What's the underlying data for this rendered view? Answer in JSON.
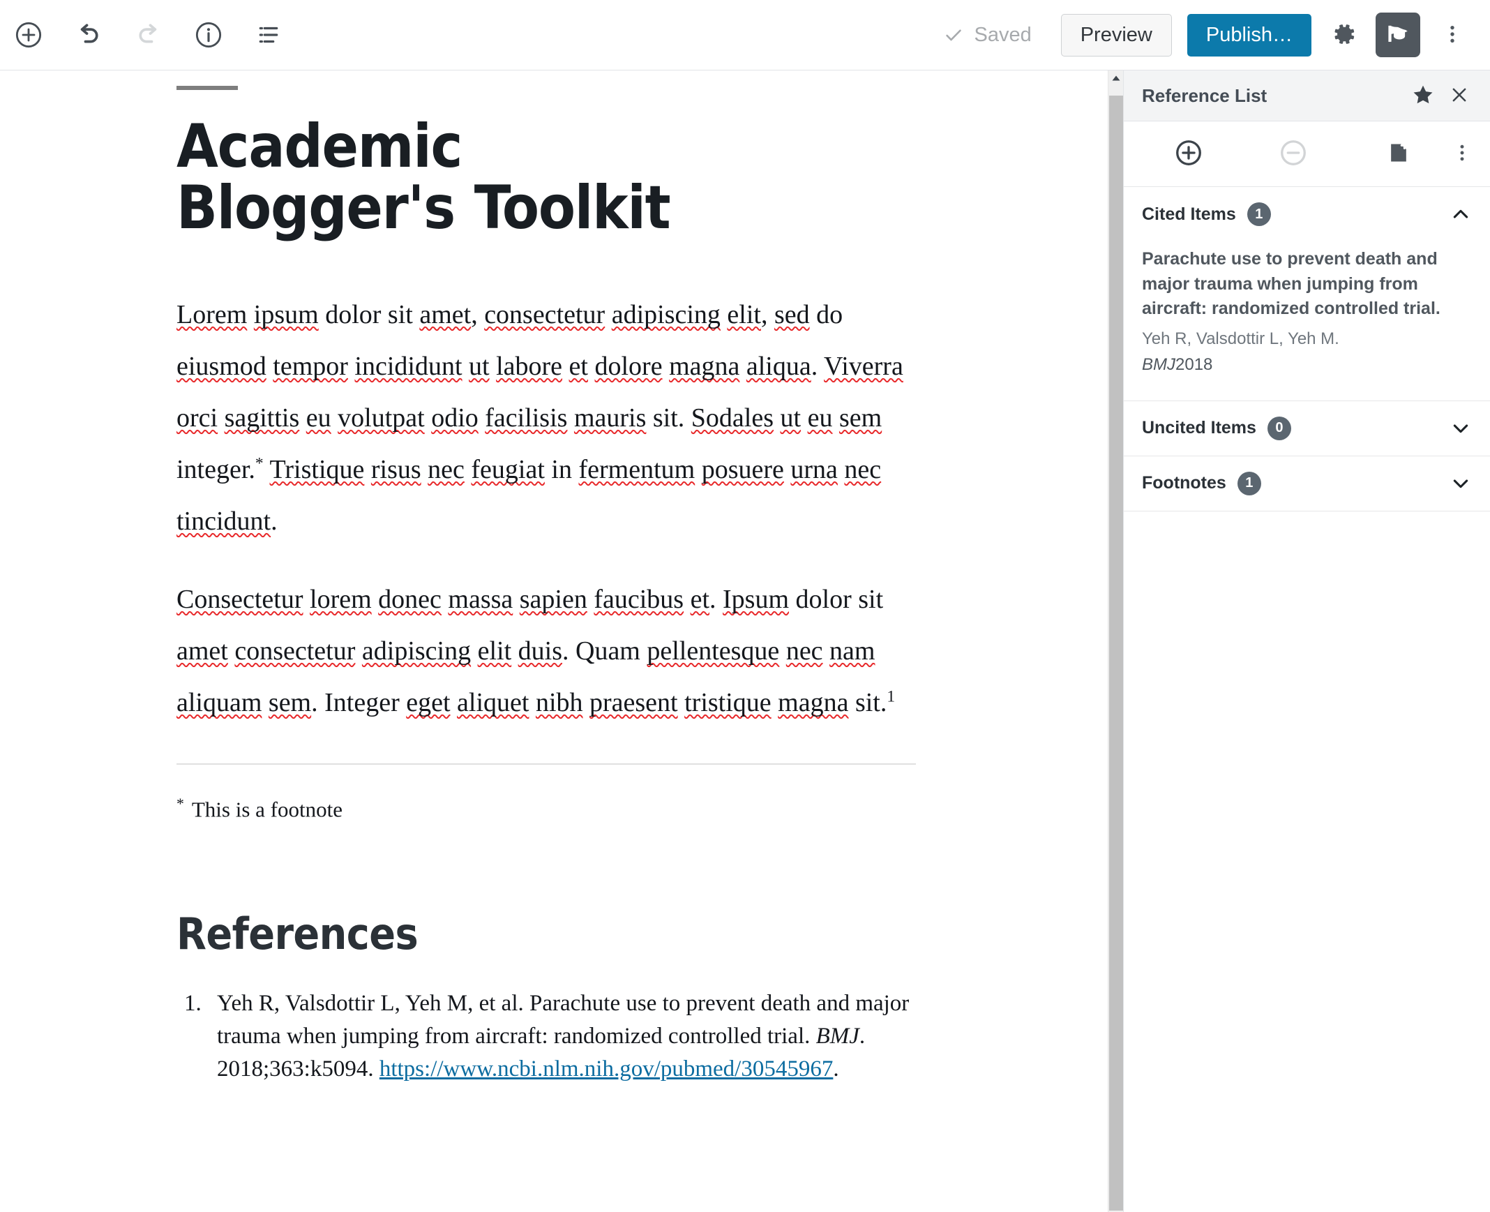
{
  "toolbar": {
    "left_buttons": [
      {
        "name": "add-block-button",
        "icon": "plus-circle-icon",
        "label": "Add block"
      },
      {
        "name": "undo-button",
        "icon": "undo-icon",
        "label": "Undo"
      },
      {
        "name": "redo-button",
        "icon": "redo-icon",
        "label": "Redo",
        "disabled": true
      },
      {
        "name": "details-button",
        "icon": "info-circle-icon",
        "label": "Details"
      },
      {
        "name": "block-navigation-button",
        "icon": "list-view-icon",
        "label": "Block navigation"
      }
    ],
    "saved_label": "Saved",
    "preview_label": "Preview",
    "publish_label": "Publish…",
    "settings_label": "Settings",
    "abt_plugin_label": "Academic Blogger's Toolkit",
    "more_label": "More tools & options",
    "publish_color": "#0c7aab",
    "active_chip_color": "#50575e"
  },
  "editor": {
    "post_title": "Academic Blogger's Toolkit",
    "paragraph_1": [
      {
        "t": "Lorem",
        "sp": true
      },
      {
        "t": " "
      },
      {
        "t": "ipsum",
        "sp": true
      },
      {
        "t": " dolor sit "
      },
      {
        "t": "amet",
        "sp": true
      },
      {
        "t": ", "
      },
      {
        "t": "consectetur",
        "sp": true
      },
      {
        "t": " "
      },
      {
        "t": "adipiscing",
        "sp": true
      },
      {
        "t": " "
      },
      {
        "t": "elit",
        "sp": true
      },
      {
        "t": ", "
      },
      {
        "t": "sed",
        "sp": true
      },
      {
        "t": " do "
      },
      {
        "t": "eiusmod",
        "sp": true
      },
      {
        "t": " "
      },
      {
        "t": "tempor",
        "sp": true
      },
      {
        "t": " "
      },
      {
        "t": "incididunt",
        "sp": true
      },
      {
        "t": " "
      },
      {
        "t": "ut",
        "sp": true
      },
      {
        "t": " "
      },
      {
        "t": "labore",
        "sp": true
      },
      {
        "t": " "
      },
      {
        "t": "et",
        "sp": true
      },
      {
        "t": " "
      },
      {
        "t": "dolore",
        "sp": true
      },
      {
        "t": " "
      },
      {
        "t": "magna",
        "sp": true
      },
      {
        "t": " "
      },
      {
        "t": "aliqua",
        "sp": true
      },
      {
        "t": ". "
      },
      {
        "t": "Viverra",
        "sp": true
      },
      {
        "t": " "
      },
      {
        "t": "orci",
        "sp": true
      },
      {
        "t": " "
      },
      {
        "t": "sagittis",
        "sp": true
      },
      {
        "t": " "
      },
      {
        "t": "eu",
        "sp": true
      },
      {
        "t": " "
      },
      {
        "t": "volutpat",
        "sp": true
      },
      {
        "t": " "
      },
      {
        "t": "odio",
        "sp": true
      },
      {
        "t": " "
      },
      {
        "t": "facilisis",
        "sp": true
      },
      {
        "t": " "
      },
      {
        "t": "mauris",
        "sp": true
      },
      {
        "t": " sit. "
      },
      {
        "t": "Sodales",
        "sp": true
      },
      {
        "t": " "
      },
      {
        "t": "ut",
        "sp": true
      },
      {
        "t": " "
      },
      {
        "t": "eu",
        "sp": true
      },
      {
        "t": " "
      },
      {
        "t": "sem",
        "sp": true
      },
      {
        "t": " integer."
      },
      {
        "t": "*",
        "sup": true
      },
      {
        "t": " "
      },
      {
        "t": "Tristique",
        "sp": true
      },
      {
        "t": " "
      },
      {
        "t": "risus",
        "sp": true
      },
      {
        "t": " "
      },
      {
        "t": "nec",
        "sp": true
      },
      {
        "t": " "
      },
      {
        "t": "feugiat",
        "sp": true
      },
      {
        "t": " in "
      },
      {
        "t": "fermentum",
        "sp": true
      },
      {
        "t": " "
      },
      {
        "t": "posuere",
        "sp": true
      },
      {
        "t": " "
      },
      {
        "t": "urna",
        "sp": true
      },
      {
        "t": " "
      },
      {
        "t": "nec",
        "sp": true
      },
      {
        "t": " "
      },
      {
        "t": "tincidunt",
        "sp": true
      },
      {
        "t": "."
      }
    ],
    "paragraph_2": [
      {
        "t": "Consectetur",
        "sp": true
      },
      {
        "t": " "
      },
      {
        "t": "lorem",
        "sp": true
      },
      {
        "t": " "
      },
      {
        "t": "donec",
        "sp": true
      },
      {
        "t": " "
      },
      {
        "t": "massa",
        "sp": true
      },
      {
        "t": " "
      },
      {
        "t": "sapien",
        "sp": true
      },
      {
        "t": " "
      },
      {
        "t": "faucibus",
        "sp": true
      },
      {
        "t": " "
      },
      {
        "t": "et",
        "sp": true
      },
      {
        "t": ". "
      },
      {
        "t": "Ipsum",
        "sp": true
      },
      {
        "t": " dolor sit "
      },
      {
        "t": "amet",
        "sp": true
      },
      {
        "t": " "
      },
      {
        "t": "consectetur",
        "sp": true
      },
      {
        "t": " "
      },
      {
        "t": "adipiscing",
        "sp": true
      },
      {
        "t": " "
      },
      {
        "t": "elit",
        "sp": true
      },
      {
        "t": " "
      },
      {
        "t": "duis",
        "sp": true
      },
      {
        "t": ". Quam "
      },
      {
        "t": "pellentesque",
        "sp": true
      },
      {
        "t": " "
      },
      {
        "t": "nec",
        "sp": true
      },
      {
        "t": " "
      },
      {
        "t": "nam",
        "sp": true
      },
      {
        "t": " "
      },
      {
        "t": "aliquam",
        "sp": true
      },
      {
        "t": " "
      },
      {
        "t": "sem",
        "sp": true
      },
      {
        "t": ". Integer "
      },
      {
        "t": "eget",
        "sp": true
      },
      {
        "t": " "
      },
      {
        "t": "aliquet",
        "sp": true
      },
      {
        "t": " "
      },
      {
        "t": "nibh",
        "sp": true
      },
      {
        "t": " "
      },
      {
        "t": "praesent",
        "sp": true
      },
      {
        "t": " "
      },
      {
        "t": "tristique",
        "sp": true
      },
      {
        "t": " "
      },
      {
        "t": "magna",
        "sp": true
      },
      {
        "t": " sit."
      },
      {
        "t": "1",
        "sup": true
      }
    ],
    "footnote_marker": "*",
    "footnote_text": "This is a footnote",
    "references_heading": "References",
    "reference_items": [
      {
        "number": "1.",
        "prefix": "Yeh R, Valsdottir L, Yeh M, et al. Parachute use to prevent death and major trauma when jumping from aircraft: randomized controlled trial. ",
        "journal": "BMJ",
        "middle": ". 2018;363:k5094. ",
        "url": "https://www.ncbi.nlm.nih.gov/pubmed/30545967",
        "suffix": "."
      }
    ]
  },
  "sidebar": {
    "panel_title": "Reference List",
    "pin_label": "Pin to toolbar",
    "close_label": "Close plugin",
    "toolbar": {
      "add_label": "Add Reference",
      "remove_label": "Remove Reference",
      "insert_note_label": "Insert Static Publication List",
      "menu_label": "Options"
    },
    "sections": [
      {
        "name": "cited-items",
        "label": "Cited Items",
        "count": "1",
        "expanded": true,
        "items": [
          {
            "title": "Parachute use to prevent death and major trauma when jumping from aircraft: randomized controlled trial.",
            "authors": "Yeh R, Valsdottir L, Yeh M.",
            "journal": "BMJ",
            "year": "2018"
          }
        ]
      },
      {
        "name": "uncited-items",
        "label": "Uncited Items",
        "count": "0",
        "expanded": false,
        "items": []
      },
      {
        "name": "footnotes",
        "label": "Footnotes",
        "count": "1",
        "expanded": false,
        "items": []
      }
    ]
  },
  "scrollbar": {
    "up_arrow_label": "Scroll up"
  }
}
